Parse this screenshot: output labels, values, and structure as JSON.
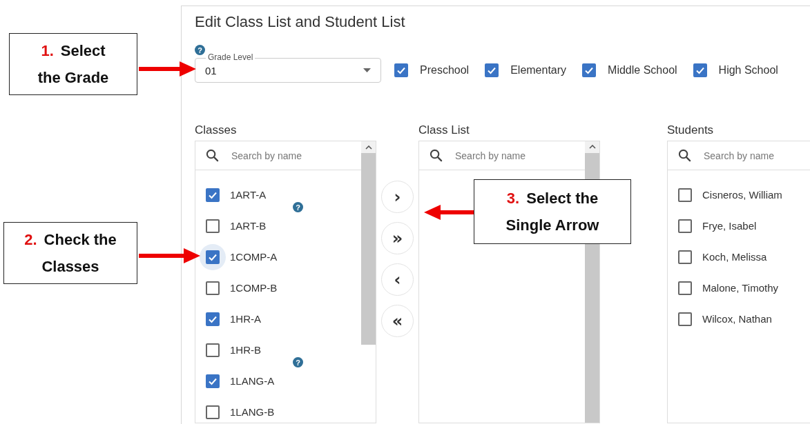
{
  "title": "Edit Class List and Student List",
  "grade": {
    "label": "Grade Level",
    "help_icon": "?",
    "value": "01"
  },
  "filters": [
    {
      "label": "Preschool",
      "checked": true
    },
    {
      "label": "Elementary",
      "checked": true
    },
    {
      "label": "Middle School",
      "checked": true
    },
    {
      "label": "High School",
      "checked": true
    }
  ],
  "classes": {
    "heading": "Classes",
    "search": {
      "placeholder": "Search by name"
    },
    "items": [
      {
        "label": "1ART-A",
        "checked": true,
        "focused": false,
        "help_icon": "?"
      },
      {
        "label": "1ART-B",
        "checked": false,
        "focused": false
      },
      {
        "label": "1COMP-A",
        "checked": true,
        "focused": true
      },
      {
        "label": "1COMP-B",
        "checked": false,
        "focused": false
      },
      {
        "label": "1HR-A",
        "checked": true,
        "focused": false
      },
      {
        "label": "1HR-B",
        "checked": false,
        "focused": false,
        "help_icon": "?"
      },
      {
        "label": "1LANG-A",
        "checked": true,
        "focused": false
      },
      {
        "label": "1LANG-B",
        "checked": false,
        "focused": false
      }
    ]
  },
  "move_buttons": [
    {
      "symbol": "›"
    },
    {
      "symbol": "»"
    },
    {
      "symbol": "‹"
    },
    {
      "symbol": "«"
    }
  ],
  "class_list": {
    "heading": "Class List",
    "search": {
      "placeholder": "Search by name"
    }
  },
  "students": {
    "heading": "Students",
    "search": {
      "placeholder": "Search by name"
    },
    "items": [
      {
        "label": "Cisneros, William",
        "checked": false
      },
      {
        "label": "Frye, Isabel",
        "checked": false
      },
      {
        "label": "Koch, Melissa",
        "checked": false
      },
      {
        "label": "Malone, Timothy",
        "checked": false
      },
      {
        "label": "Wilcox, Nathan",
        "checked": false
      }
    ]
  },
  "callouts": [
    {
      "number": "1.",
      "lines": [
        "Select",
        "the Grade"
      ]
    },
    {
      "number": "2.",
      "lines": [
        "Check the",
        "Classes"
      ]
    },
    {
      "number": "3.",
      "lines": [
        "Select the",
        "Single Arrow"
      ]
    }
  ]
}
